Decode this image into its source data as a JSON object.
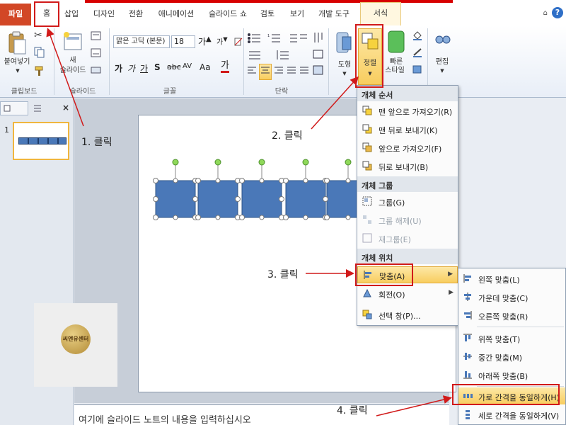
{
  "tabs": [
    "파일",
    "홈",
    "삽입",
    "디자인",
    "전환",
    "애니메이션",
    "슬라이드 쇼",
    "검토",
    "보기",
    "개발 도구",
    "서식"
  ],
  "ribbon": {
    "paste_label": "붙여넣기",
    "new_slide_line1": "새",
    "new_slide_line2": "슬라이드",
    "font_name": "맑은 고딕 (본문)",
    "font_size": "18",
    "shape_label": "도형",
    "arrange_label": "정렬",
    "quick_style_line1": "빠른",
    "quick_style_line2": "스타일",
    "edit_label": "편집",
    "groups": {
      "clipboard": "클립보드",
      "slides": "슬라이드",
      "font": "글꼴",
      "paragraph": "단락"
    }
  },
  "slide_panel": {
    "slide_number": "1"
  },
  "notes_placeholder": "여기에 슬라이드 노트의 내용을 입력하십시오",
  "stamp_text": "씨앤유센터",
  "menu": {
    "section_order": "개체 순서",
    "bring_front": "맨 앞으로 가져오기(R)",
    "send_back": "맨 뒤로 보내기(K)",
    "bring_forward": "앞으로 가져오기(F)",
    "send_backward": "뒤로 보내기(B)",
    "section_group": "개체 그룹",
    "group": "그룹(G)",
    "ungroup": "그룹 해제(U)",
    "regroup": "재그룹(E)",
    "section_position": "개체 위치",
    "align": "맞춤(A)",
    "rotate": "회전(O)",
    "selection_pane": "선택 창(P)..."
  },
  "submenu": {
    "align_left": "왼쪽 맞춤(L)",
    "align_center": "가운데 맞춤(C)",
    "align_right": "오른쪽 맞춤(R)",
    "align_top": "위쪽 맞춤(T)",
    "align_middle": "중간 맞춤(M)",
    "align_bottom": "아래쪽 맞춤(B)",
    "distribute_h": "가로 간격을 동일하게(H)",
    "distribute_v": "세로 간격을 동일하게(V)"
  },
  "callouts": {
    "step1": "1. 클릭",
    "step2": "2. 클릭",
    "step3": "3. 클릭",
    "step4": "4. 클릭"
  },
  "colors": {
    "shape_fill": "#4a78b8",
    "annotation_red": "#d11a1a",
    "file_tab": "#d24726"
  }
}
